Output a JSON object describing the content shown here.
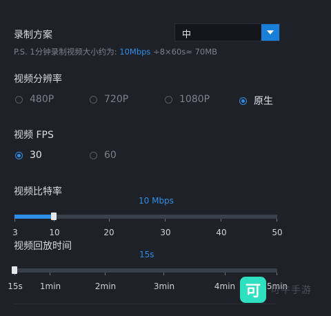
{
  "record": {
    "title": "录制方案",
    "dropdown_value": "中",
    "hint_prefix": "P.S. 1分钟录制视频大小约为: ",
    "hint_rate": "10Mbps",
    "hint_suffix": " ÷8×60s≈ 70MB"
  },
  "resolution": {
    "title": "视频分辨率",
    "options": [
      "480P",
      "720P",
      "1080P",
      "原生"
    ],
    "selected": "原生"
  },
  "fps": {
    "title": "视频 FPS",
    "options": [
      "30",
      "60"
    ],
    "selected": "30"
  },
  "bitrate": {
    "title": "视频比特率",
    "value_label": "10 Mbps",
    "ticks": [
      "3",
      "10",
      "20",
      "30",
      "40",
      "50"
    ],
    "value": 10
  },
  "playback": {
    "title": "视频回放时间",
    "value_label": "15s",
    "ticks": [
      "15s",
      "1min",
      "2min",
      "3min",
      "4min",
      "5min"
    ],
    "value": "15s"
  },
  "watermark": {
    "logo_glyph": "可",
    "text": "可牛手游"
  },
  "colors": {
    "accent": "#2f8fe6",
    "background": "#1f2129",
    "logo": "#2fe0c0"
  }
}
